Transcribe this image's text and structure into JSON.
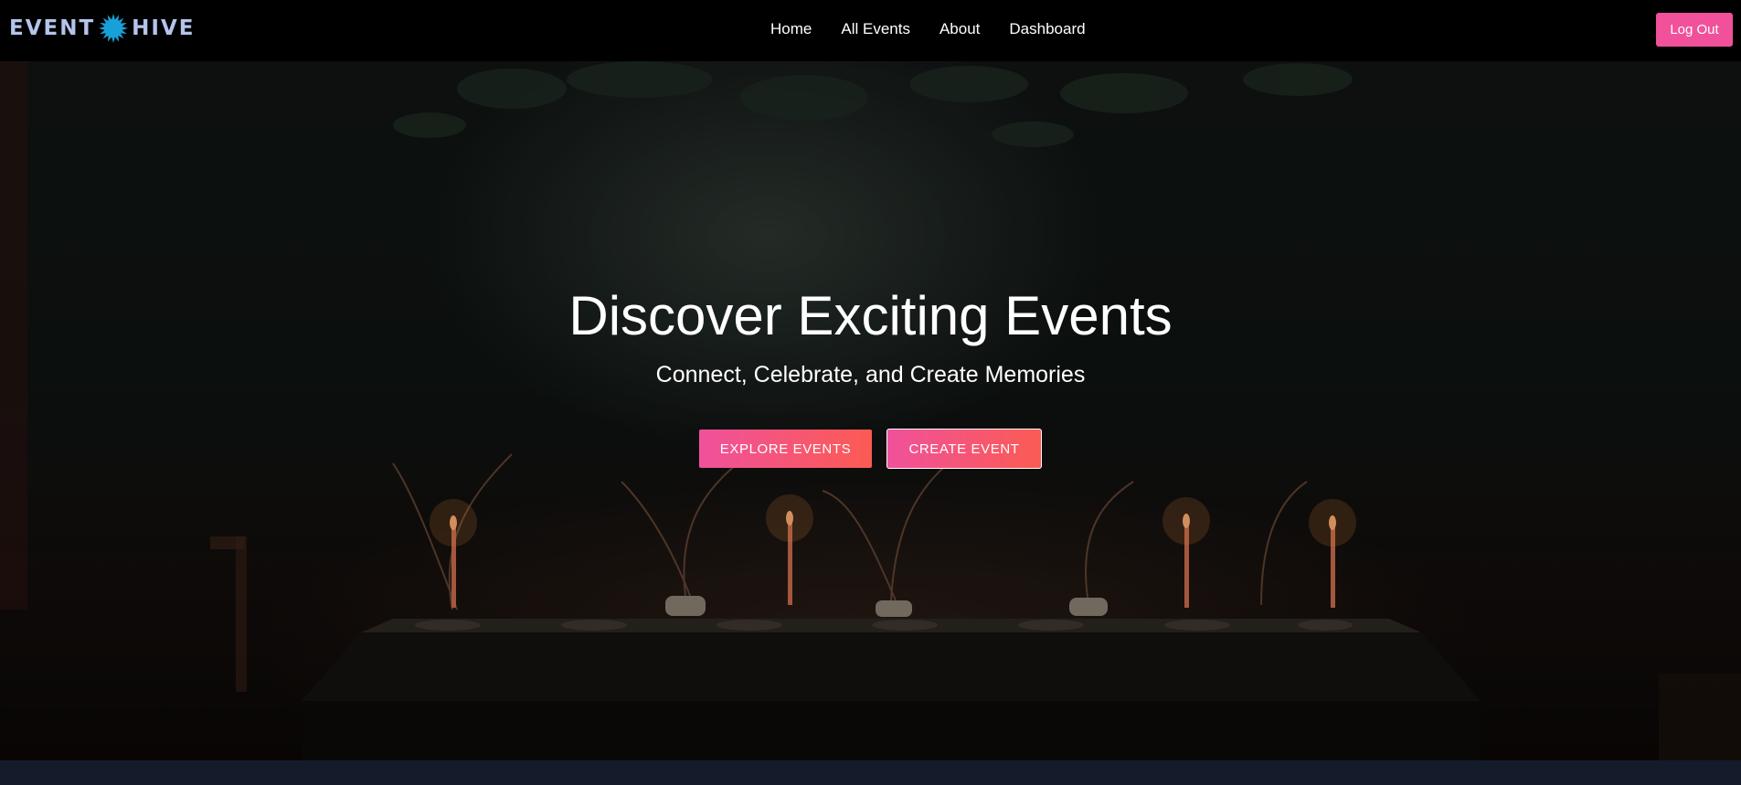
{
  "brand": {
    "left_text": "EVENT",
    "right_text": "HIVE",
    "logo_icon": "gear-sun-icon",
    "logo_color": "#b4c4ec",
    "icon_color": "#1aa0d8"
  },
  "nav": {
    "links": [
      {
        "label": "Home"
      },
      {
        "label": "All Events"
      },
      {
        "label": "About"
      },
      {
        "label": "Dashboard"
      }
    ],
    "logout_label": "Log Out"
  },
  "hero": {
    "title": "Discover Exciting Events",
    "subtitle": "Connect, Celebrate, and Create Memories",
    "explore_label": "EXPLORE EVENTS",
    "create_label": "CREATE EVENT",
    "background_description_icon": "dinner-table-candles-photo"
  },
  "colors": {
    "accent_pink": "#f0519a",
    "accent_coral": "#fb5b52",
    "navbar_bg": "#000000",
    "footer_bg": "#141b2b"
  }
}
